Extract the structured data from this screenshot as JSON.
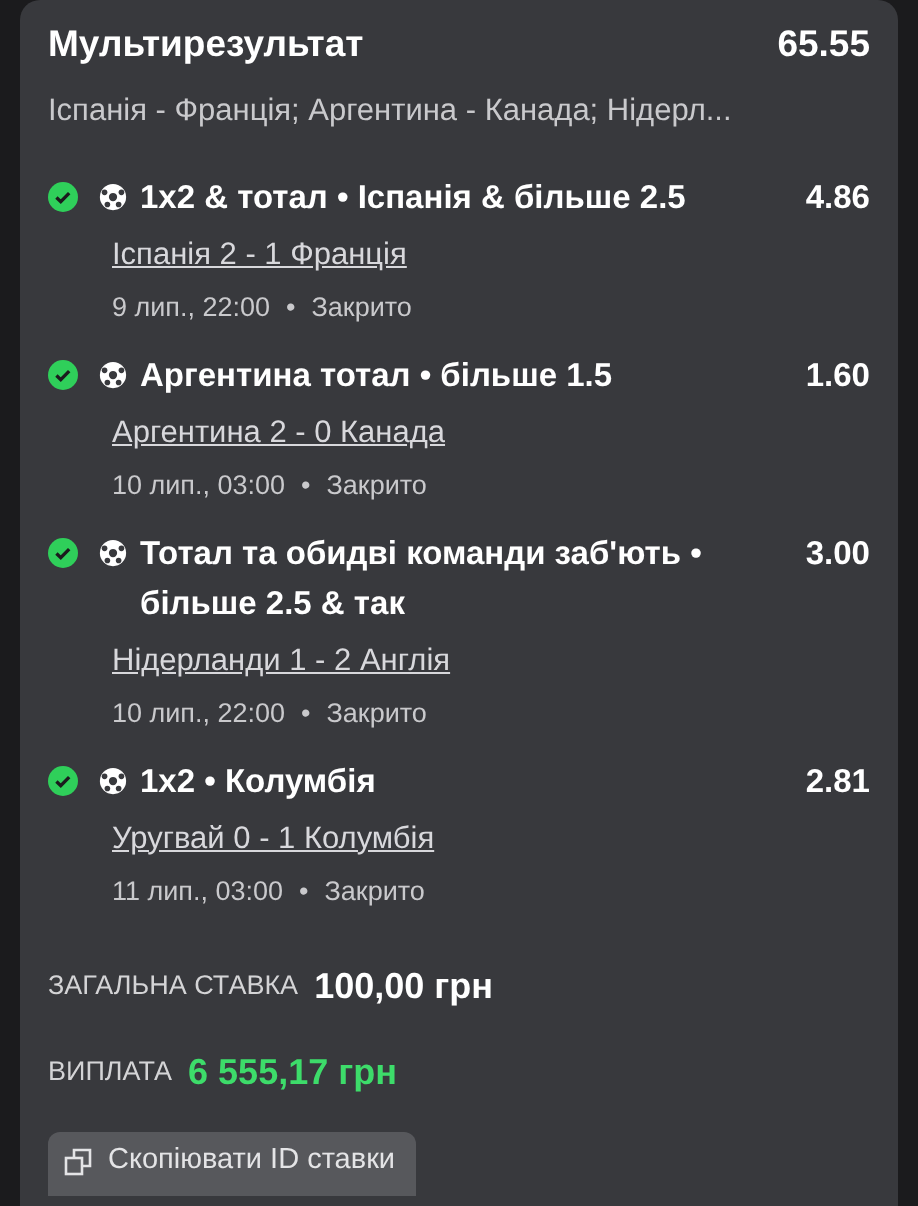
{
  "bet": {
    "title": "Мультирезультат",
    "odds": "65.55",
    "matches_summary": "Іспанія - Франція; Аргентина - Канада; Нідерл..."
  },
  "selections": [
    {
      "won": true,
      "title": "1x2 & тотал  •  Іспанія & більше 2.5",
      "odds": "4.86",
      "result": "Іспанія 2 - 1 Франція",
      "date": "9 лип., 22:00",
      "separator": "•",
      "status": "Закрито"
    },
    {
      "won": true,
      "title": "Аргентина тотал  •  більше 1.5",
      "odds": "1.60",
      "result": "Аргентина 2 - 0 Канада",
      "date": "10 лип., 03:00",
      "separator": "•",
      "status": "Закрито"
    },
    {
      "won": true,
      "title": "Тотал та обидві команди заб'ють  •  більше 2.5 & так",
      "odds": "3.00",
      "result": "Нідерланди 1 - 2 Англія",
      "date": "10 лип., 22:00",
      "separator": "•",
      "status": "Закрито"
    },
    {
      "won": true,
      "title": "1x2  •  Колумбія",
      "odds": "2.81",
      "result": "Уругвай 0 - 1 Колумбія",
      "date": "11 лип., 03:00",
      "separator": "•",
      "status": "Закрито"
    }
  ],
  "stake": {
    "label": "ЗАГАЛЬНА СТАВКА",
    "value": "100,00 грн"
  },
  "payout": {
    "label": "ВИПЛАТА",
    "value": "6 555,17 грн"
  },
  "copy_button": {
    "label": "Скопіювати ID ставки"
  }
}
